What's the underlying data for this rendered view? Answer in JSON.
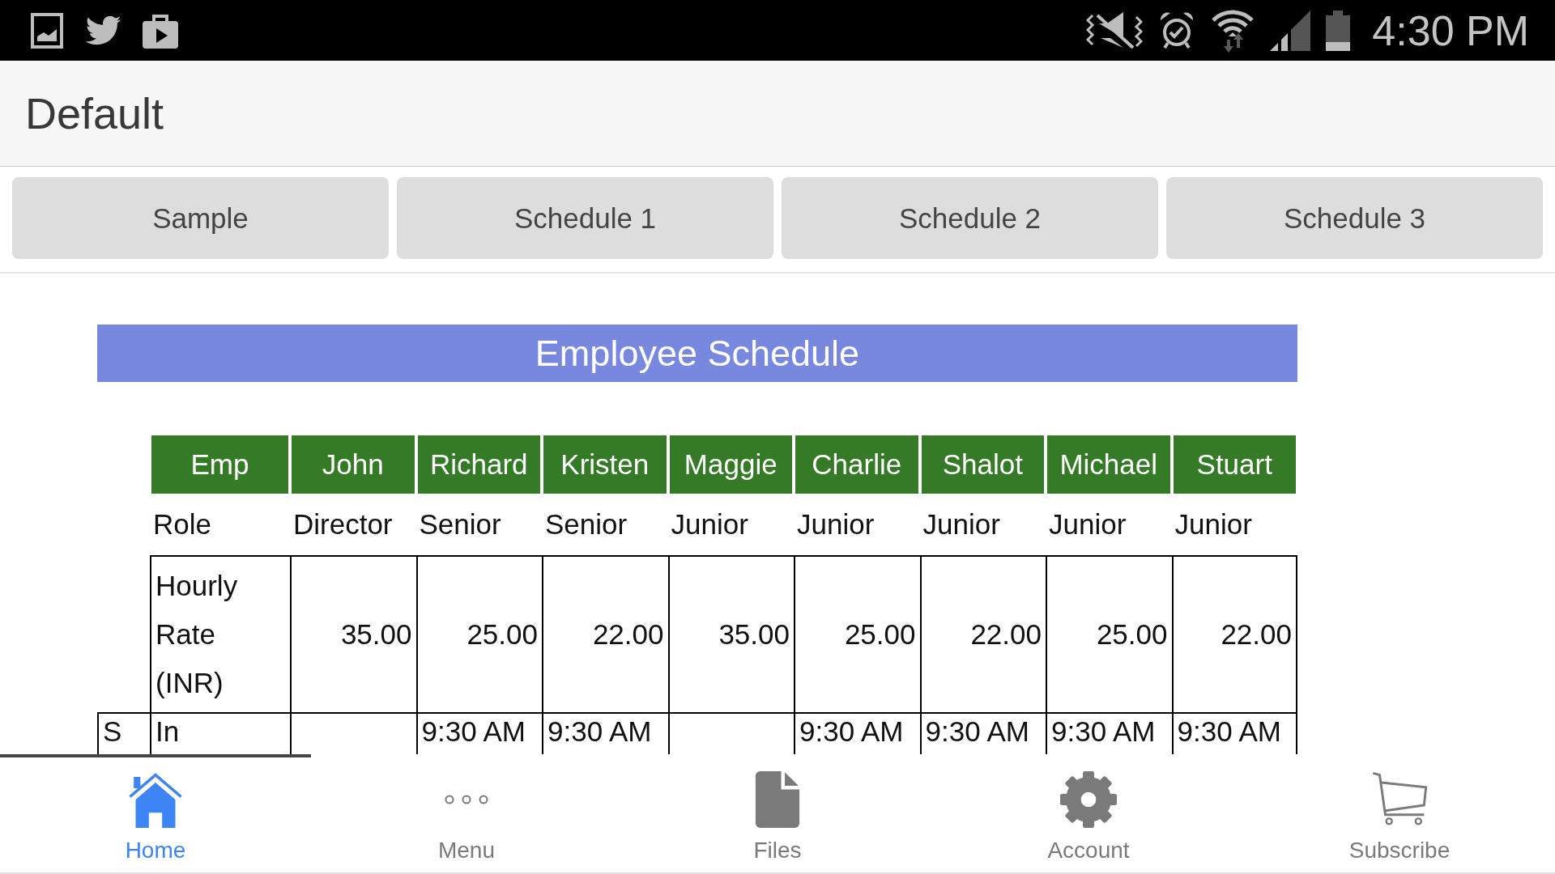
{
  "status_bar": {
    "time": "4:30 PM"
  },
  "app_bar": {
    "title": "Default"
  },
  "schedule_buttons": [
    "Sample",
    "Schedule 1",
    "Schedule 2",
    "Schedule 3"
  ],
  "schedule": {
    "title": "Employee Schedule",
    "columns": [
      "Emp",
      "John",
      "Richard",
      "Kristen",
      "Maggie",
      "Charlie",
      "Shalot",
      "Michael",
      "Stuart"
    ],
    "rows": [
      {
        "kind": "plain",
        "cells": [
          "Role",
          "Director",
          "Senior",
          "Senior",
          "Junior",
          "Junior",
          "Junior",
          "Junior",
          "Junior"
        ]
      },
      {
        "kind": "rate",
        "cells": [
          "Hourly Rate (INR)",
          "35.00",
          "25.00",
          "22.00",
          "35.00",
          "25.00",
          "22.00",
          "25.00",
          "22.00"
        ]
      },
      {
        "kind": "shift",
        "group": "S",
        "cells": [
          "In",
          null,
          "9:30 AM",
          "9:30 AM",
          null,
          "9:30 AM",
          "9:30 AM",
          "9:30 AM",
          "9:30 AM"
        ]
      }
    ]
  },
  "bottom_nav": {
    "items": [
      {
        "label": "Home",
        "selected": true
      },
      {
        "label": "Menu",
        "selected": false
      },
      {
        "label": "Files",
        "selected": false
      },
      {
        "label": "Account",
        "selected": false
      },
      {
        "label": "Subscribe",
        "selected": false
      }
    ]
  }
}
